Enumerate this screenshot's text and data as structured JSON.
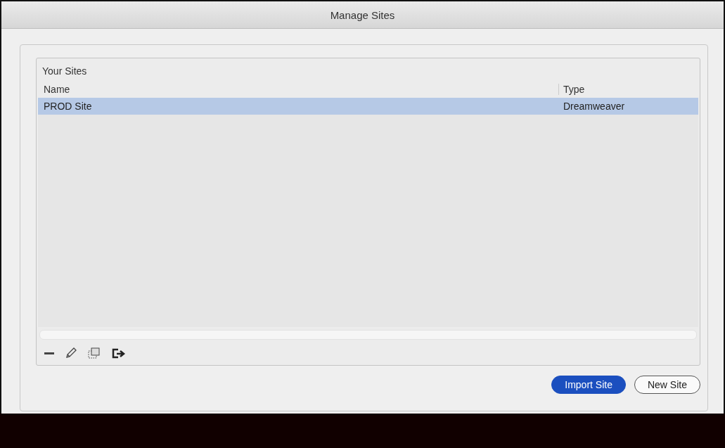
{
  "window": {
    "title": "Manage Sites"
  },
  "panel": {
    "title": "Your Sites"
  },
  "table": {
    "columns": [
      "Name",
      "Type"
    ],
    "rows": [
      {
        "name": "PROD Site",
        "type": "Dreamweaver",
        "selected": true
      }
    ]
  },
  "buttons": [
    {
      "label": "Import Site",
      "kind": "primary"
    },
    {
      "label": "New Site",
      "kind": "secondary"
    }
  ]
}
